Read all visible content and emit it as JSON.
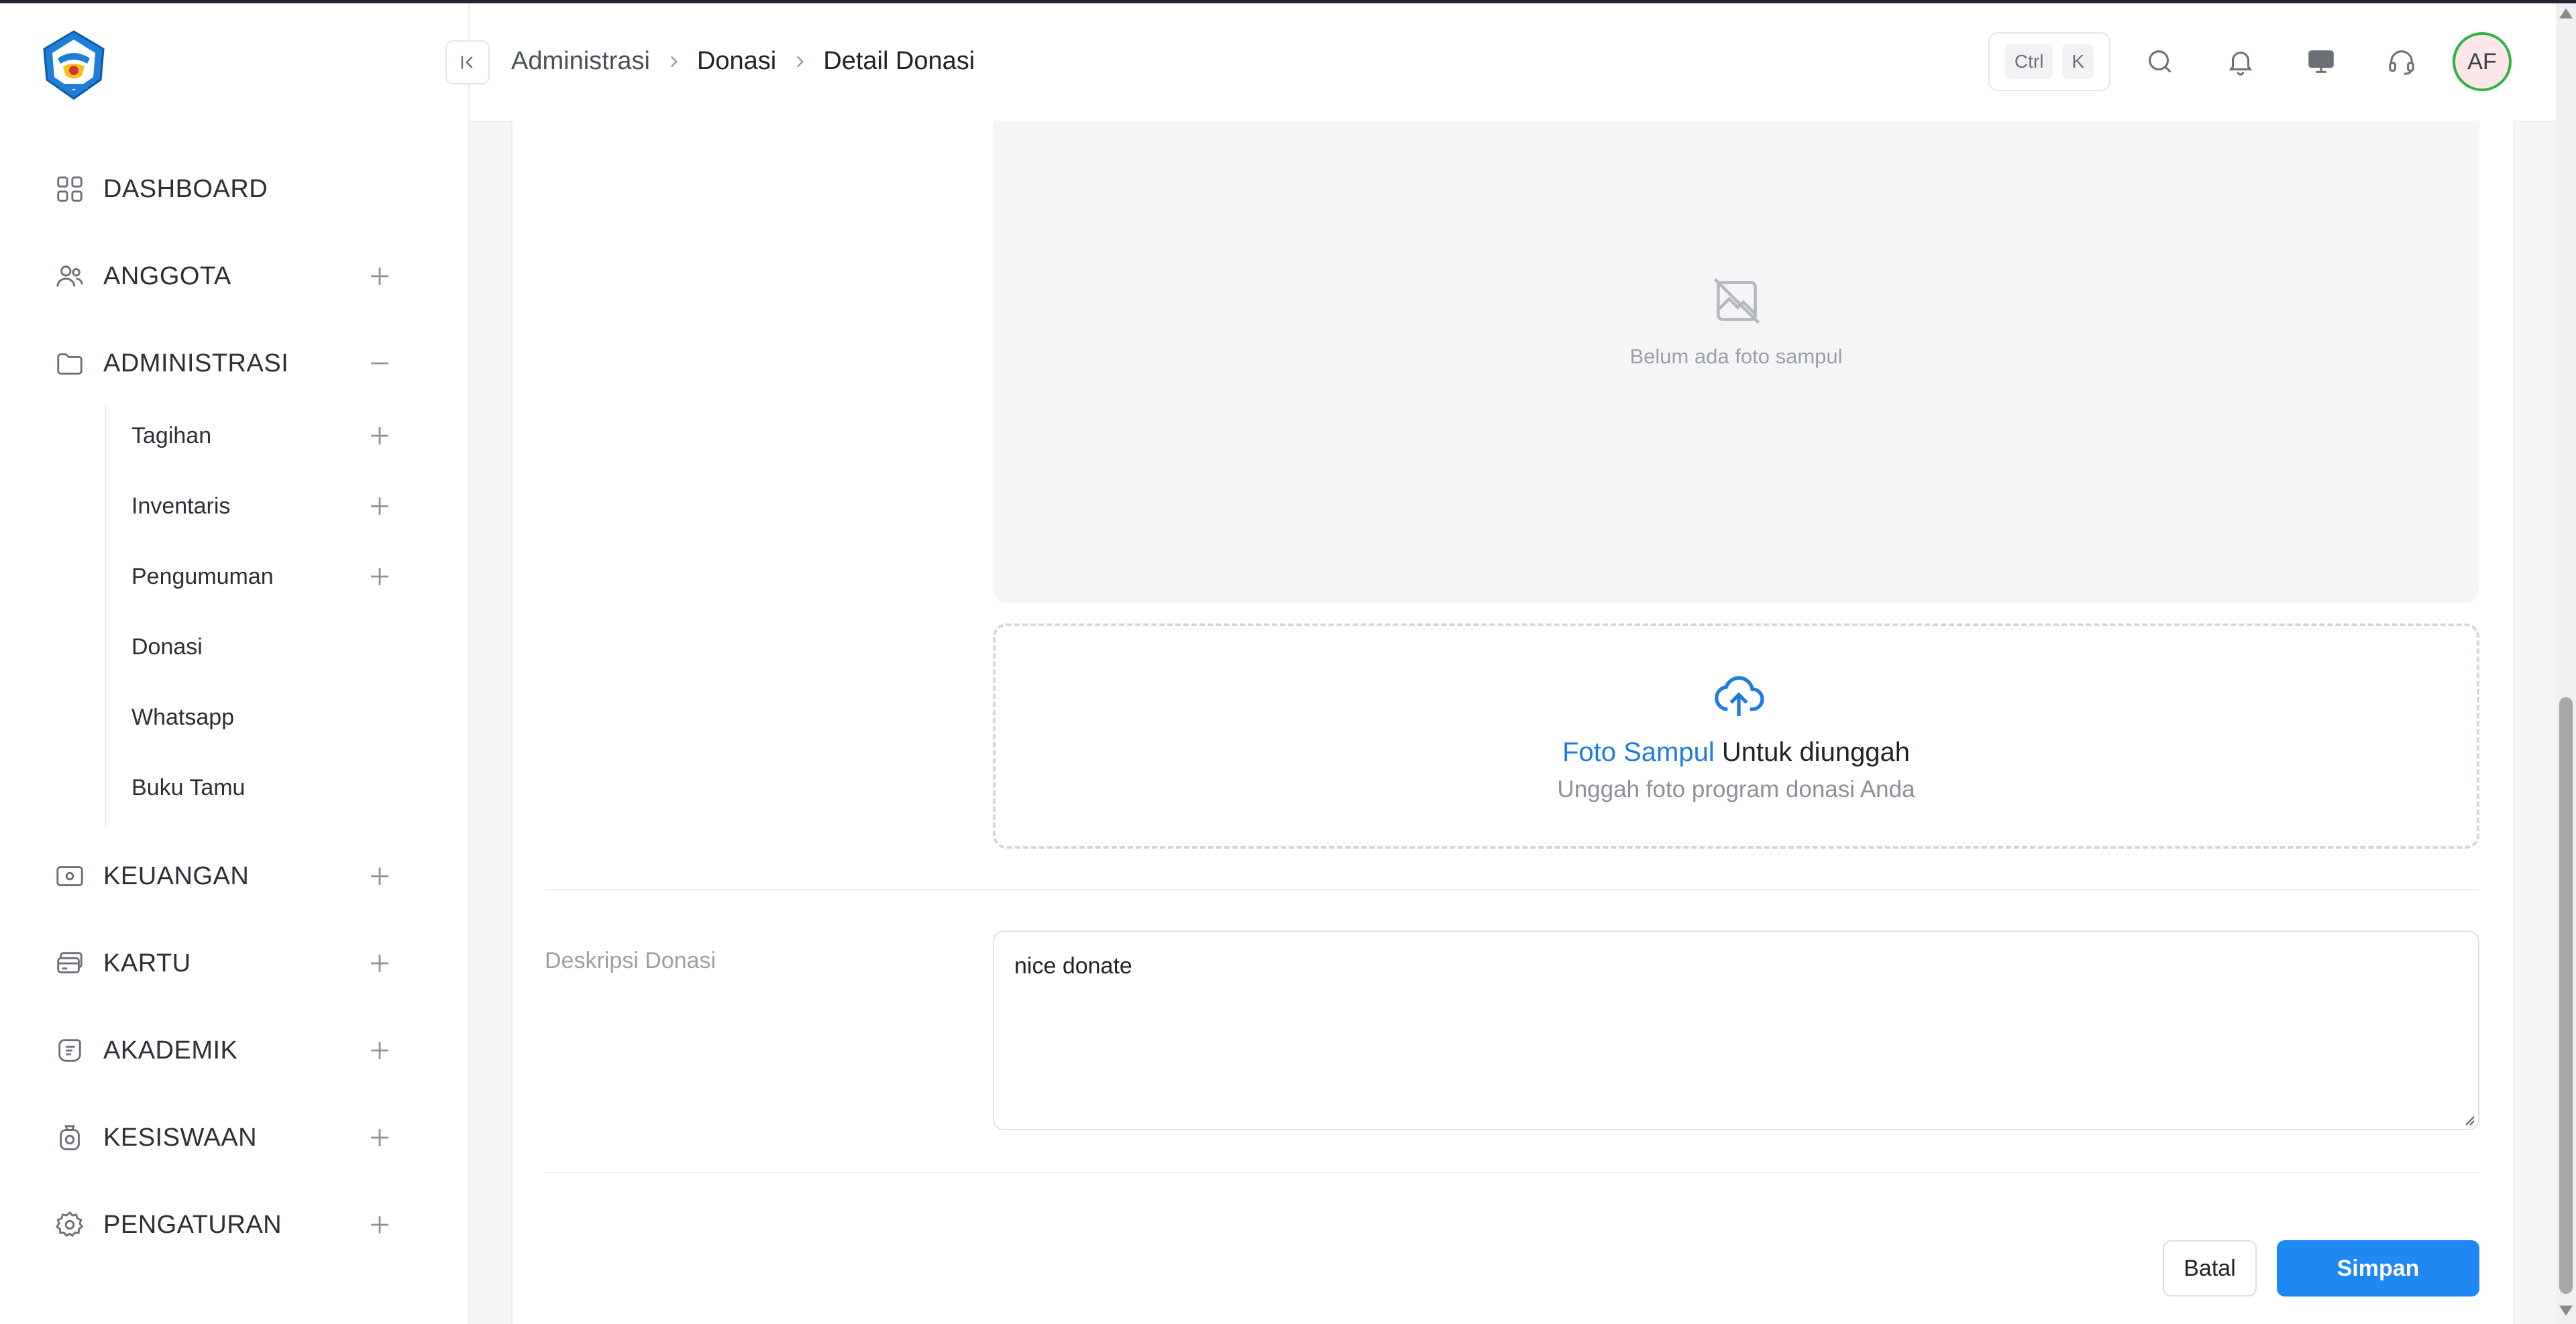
{
  "sidebar": {
    "items": [
      {
        "label": "DASHBOARD",
        "icon": "grid-icon",
        "toggle": "none"
      },
      {
        "label": "ANGGOTA",
        "icon": "users-icon",
        "toggle": "plus"
      },
      {
        "label": "ADMINISTRASI",
        "icon": "folder-icon",
        "toggle": "minus"
      },
      {
        "label": "KEUANGAN",
        "icon": "money-icon",
        "toggle": "plus"
      },
      {
        "label": "KARTU",
        "icon": "card-icon",
        "toggle": "plus"
      },
      {
        "label": "AKADEMIK",
        "icon": "academic-icon",
        "toggle": "plus"
      },
      {
        "label": "KESISWAAN",
        "icon": "student-icon",
        "toggle": "plus"
      },
      {
        "label": "PENGATURAN",
        "icon": "gear-icon",
        "toggle": "plus"
      }
    ],
    "sub_items": [
      {
        "label": "Tagihan",
        "toggle": "plus"
      },
      {
        "label": "Inventaris",
        "toggle": "plus"
      },
      {
        "label": "Pengumuman",
        "toggle": "plus"
      },
      {
        "label": "Donasi",
        "toggle": "none"
      },
      {
        "label": "Whatsapp",
        "toggle": "none"
      },
      {
        "label": "Buku Tamu",
        "toggle": "none"
      }
    ]
  },
  "header": {
    "breadcrumb": [
      "Administrasi",
      "Donasi",
      "Detail Donasi"
    ],
    "shortcut_keys": [
      "Ctrl",
      "K"
    ],
    "avatar_initials": "AF"
  },
  "form": {
    "preview_empty_text": "Belum ada foto sampul",
    "upload_link": "Foto Sampul",
    "upload_title_rest": " Untuk diunggah",
    "upload_subtitle": "Unggah foto program donasi Anda",
    "description_label": "Deskripsi Donasi",
    "description_value": "nice donate",
    "cancel_label": "Batal",
    "save_label": "Simpan"
  },
  "colors": {
    "primary": "#2088f2",
    "link": "#1e7be0",
    "avatar_ring": "#2fb344",
    "avatar_bg": "#fde6ea"
  }
}
